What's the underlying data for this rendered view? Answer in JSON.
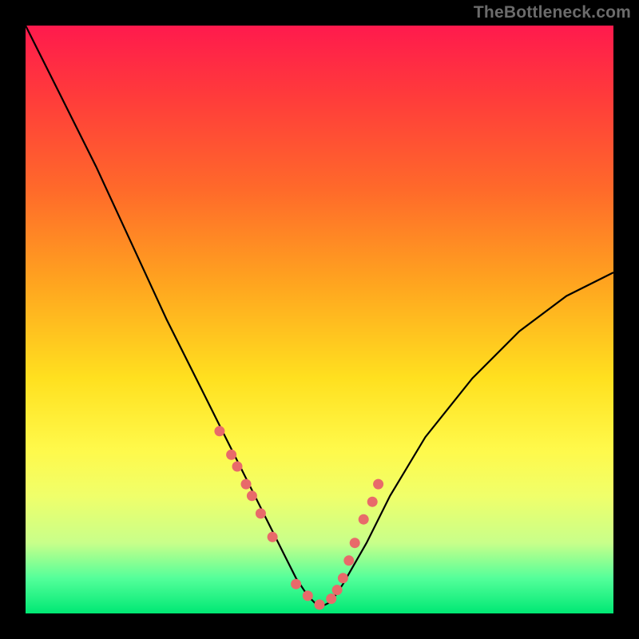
{
  "watermark": "TheBottleneck.com",
  "colors": {
    "background": "#000000",
    "curve": "#000000",
    "dots": "#e86a6a",
    "gradient_top": "#ff1a4d",
    "gradient_bottom": "#00e874"
  },
  "chart_data": {
    "type": "line",
    "title": "",
    "xlabel": "",
    "ylabel": "",
    "xlim": [
      0,
      100
    ],
    "ylim": [
      0,
      100
    ],
    "series": [
      {
        "name": "bottleneck-curve",
        "x": [
          0,
          6,
          12,
          18,
          24,
          30,
          34,
          38,
          42,
          44,
          46,
          48,
          50,
          52,
          54,
          58,
          62,
          68,
          76,
          84,
          92,
          100
        ],
        "y": [
          100,
          88,
          76,
          63,
          50,
          38,
          30,
          22,
          14,
          10,
          6,
          3,
          1,
          2,
          5,
          12,
          20,
          30,
          40,
          48,
          54,
          58
        ]
      }
    ],
    "markers": {
      "name": "highlight-dots",
      "x": [
        33,
        35,
        36,
        37.5,
        38.5,
        40,
        42,
        46,
        48,
        50,
        52,
        53,
        54,
        55,
        56,
        57.5,
        59,
        60
      ],
      "y": [
        31,
        27,
        25,
        22,
        20,
        17,
        13,
        5,
        3,
        1.5,
        2.5,
        4,
        6,
        9,
        12,
        16,
        19,
        22
      ]
    }
  }
}
